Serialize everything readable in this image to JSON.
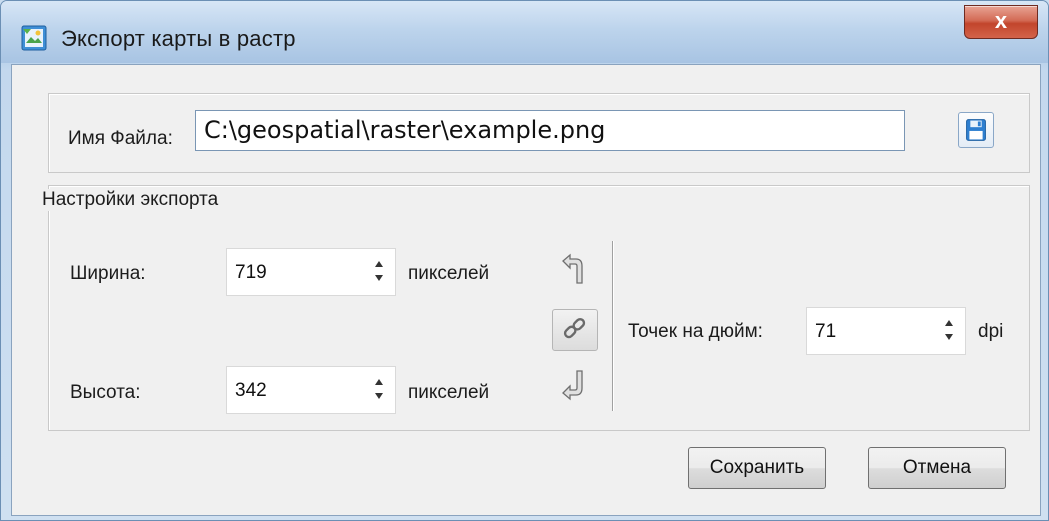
{
  "window": {
    "title": "Экспорт карты в растр",
    "close_label": "x"
  },
  "file": {
    "label": "Имя Файла:",
    "value": "C:\\geospatial\\raster\\example.png"
  },
  "settings": {
    "group_title": "Настройки экспорта",
    "width": {
      "label": "Ширина:",
      "value": "719",
      "unit": "пикселей"
    },
    "height": {
      "label": "Высота:",
      "value": "342",
      "unit": "пикселей"
    },
    "dpi": {
      "label": "Точек на дюйм:",
      "value": "71",
      "unit": "dpi"
    }
  },
  "buttons": {
    "save": "Сохранить",
    "cancel": "Отмена"
  },
  "icons": {
    "app": "export-map-icon",
    "save_file": "floppy-disk-icon",
    "link": "chain-link-icon",
    "width_arrow": "return-arrow-up-icon",
    "height_arrow": "return-arrow-down-icon"
  }
}
